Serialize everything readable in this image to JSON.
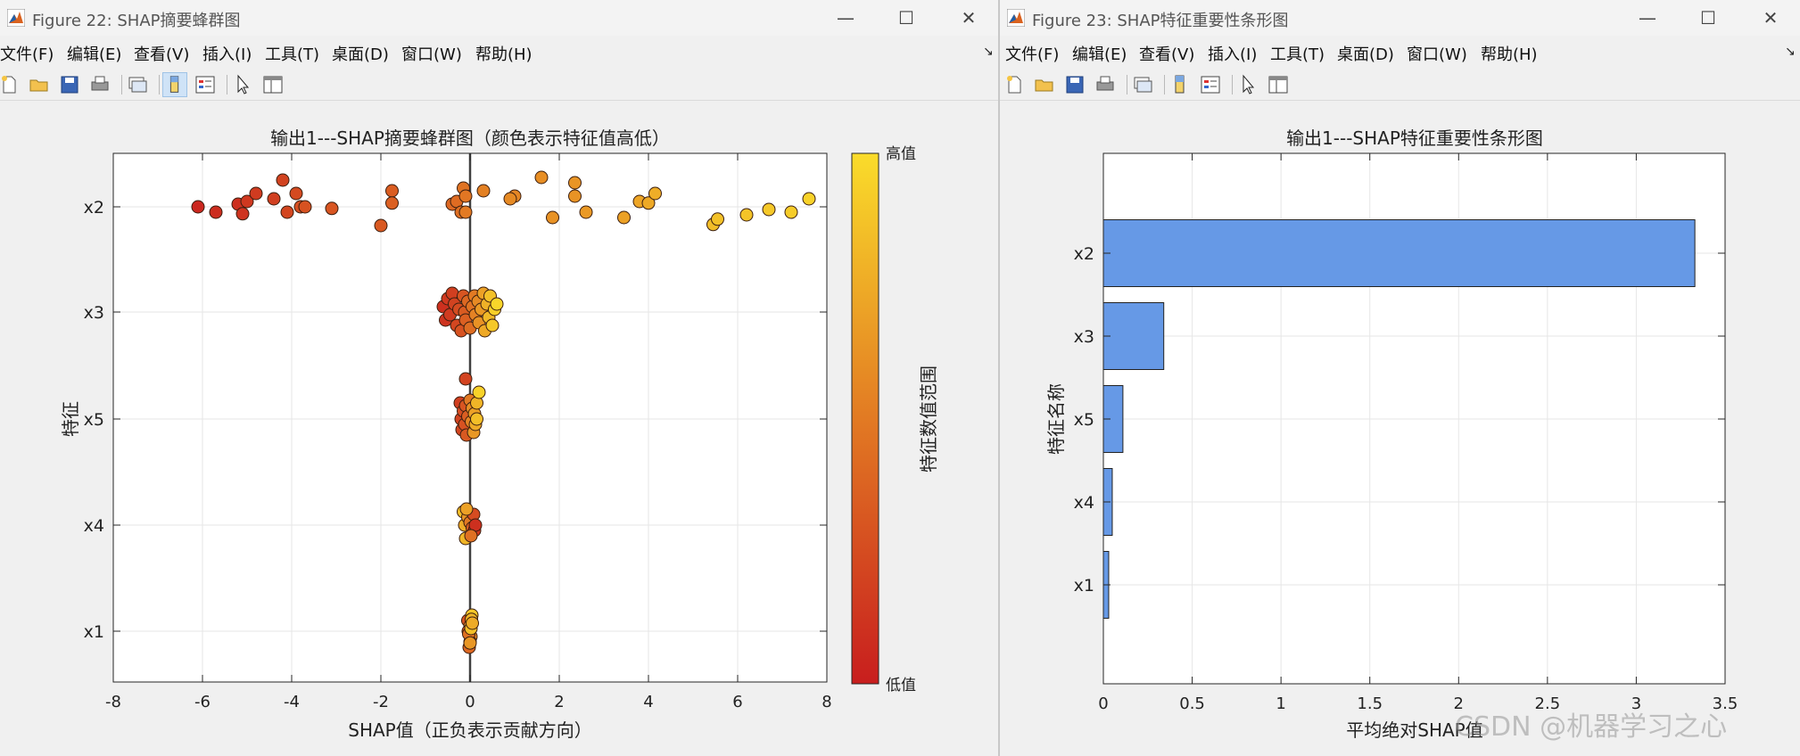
{
  "windows": [
    {
      "id": "left",
      "title": "Figure 22: SHAP摘要蜂群图",
      "menu": [
        "文件(F)",
        "编辑(E)",
        "查看(V)",
        "插入(I)",
        "工具(T)",
        "桌面(D)",
        "窗口(W)",
        "帮助(H)"
      ],
      "menu_arrow": "↘",
      "toolbar_icons": [
        "new-file-icon",
        "open-folder-icon",
        "save-icon",
        "print-icon",
        "link-plot-icon",
        "colorbar-icon",
        "legend-icon",
        "pointer-icon",
        "property-editor-icon"
      ],
      "window_controls": {
        "minimize": "—",
        "maximize": "☐",
        "close": "✕"
      }
    },
    {
      "id": "right",
      "title": "Figure 23: SHAP特征重要性条形图",
      "menu": [
        "文件(F)",
        "编辑(E)",
        "查看(V)",
        "插入(I)",
        "工具(T)",
        "桌面(D)",
        "窗口(W)",
        "帮助(H)"
      ],
      "menu_arrow": "↘",
      "toolbar_icons": [
        "new-file-icon",
        "open-folder-icon",
        "save-icon",
        "print-icon",
        "link-plot-icon",
        "colorbar-icon",
        "legend-icon",
        "pointer-icon",
        "property-editor-icon"
      ],
      "window_controls": {
        "minimize": "—",
        "maximize": "☐",
        "close": "✕"
      }
    }
  ],
  "colors": {
    "bar_fill": "#6699e6",
    "colormap_low": "#c81e1e",
    "colormap_high": "#fadc2a"
  },
  "watermark": "CSDN @机器学习之心",
  "chart_data": [
    {
      "type": "scatter",
      "title": "输出1---SHAP摘要蜂群图（颜色表示特征值高低）",
      "xlabel": "SHAP值（正负表示贡献方向）",
      "ylabel": "特征",
      "xlim": [
        -8,
        8
      ],
      "xticks": [
        -8,
        -6,
        -4,
        -2,
        0,
        2,
        4,
        6,
        8
      ],
      "categories": [
        "x2",
        "x3",
        "x5",
        "x4",
        "x1"
      ],
      "grid": true,
      "colorbar": {
        "label": "特征数值范围",
        "high_label": "高值",
        "low_label": "低值"
      },
      "series": [
        {
          "feature": "x2",
          "points": [
            [
              -6.1,
              0.0,
              0.05
            ],
            [
              -5.7,
              -0.1,
              0.08
            ],
            [
              -5.2,
              0.05,
              0.1
            ],
            [
              -5.1,
              -0.13,
              0.12
            ],
            [
              -5.0,
              0.1,
              0.14
            ],
            [
              -4.8,
              0.25,
              0.16
            ],
            [
              -4.4,
              0.15,
              0.18
            ],
            [
              -4.2,
              0.5,
              0.2
            ],
            [
              -4.1,
              -0.1,
              0.22
            ],
            [
              -3.9,
              0.25,
              0.24
            ],
            [
              -3.8,
              0.0,
              0.26
            ],
            [
              -3.7,
              0.0,
              0.28
            ],
            [
              -3.1,
              -0.03,
              0.3
            ],
            [
              -2.0,
              -0.35,
              0.32
            ],
            [
              -1.75,
              0.3,
              0.34
            ],
            [
              -1.75,
              0.07,
              0.36
            ],
            [
              -0.4,
              0.05,
              0.4
            ],
            [
              -0.3,
              0.1,
              0.42
            ],
            [
              -0.2,
              -0.1,
              0.44
            ],
            [
              -0.15,
              0.35,
              0.46
            ],
            [
              -0.1,
              0.2,
              0.48
            ],
            [
              -0.1,
              -0.1,
              0.5
            ],
            [
              0.3,
              0.3,
              0.53
            ],
            [
              1.0,
              0.2,
              0.56
            ],
            [
              0.9,
              0.15,
              0.58
            ],
            [
              1.6,
              0.55,
              0.6
            ],
            [
              1.85,
              -0.2,
              0.62
            ],
            [
              2.35,
              0.2,
              0.63
            ],
            [
              2.35,
              0.45,
              0.64
            ],
            [
              2.6,
              -0.1,
              0.66
            ],
            [
              3.45,
              -0.2,
              0.7
            ],
            [
              3.8,
              0.1,
              0.72
            ],
            [
              4.0,
              0.07,
              0.74
            ],
            [
              4.15,
              0.25,
              0.76
            ],
            [
              5.45,
              -0.33,
              0.84
            ],
            [
              5.55,
              -0.23,
              0.86
            ],
            [
              6.2,
              -0.15,
              0.88
            ],
            [
              6.7,
              -0.05,
              0.9
            ],
            [
              7.2,
              -0.1,
              0.92
            ],
            [
              7.6,
              0.15,
              0.95
            ]
          ]
        },
        {
          "feature": "x3",
          "points": [
            [
              -0.6,
              0.1,
              0.1
            ],
            [
              -0.55,
              -0.15,
              0.12
            ],
            [
              -0.5,
              0.25,
              0.14
            ],
            [
              -0.45,
              -0.05,
              0.16
            ],
            [
              -0.4,
              0.35,
              0.18
            ],
            [
              -0.35,
              0.15,
              0.2
            ],
            [
              -0.3,
              -0.25,
              0.22
            ],
            [
              -0.25,
              0.05,
              0.25
            ],
            [
              -0.2,
              -0.35,
              0.28
            ],
            [
              -0.15,
              0.3,
              0.3
            ],
            [
              -0.12,
              0.0,
              0.33
            ],
            [
              -0.1,
              -0.15,
              0.36
            ],
            [
              -0.05,
              0.2,
              0.4
            ],
            [
              0.0,
              -0.3,
              0.43
            ],
            [
              0.05,
              0.1,
              0.46
            ],
            [
              0.1,
              0.3,
              0.5
            ],
            [
              0.12,
              -0.05,
              0.54
            ],
            [
              0.18,
              0.2,
              0.58
            ],
            [
              0.2,
              -0.2,
              0.62
            ],
            [
              0.25,
              0.05,
              0.66
            ],
            [
              0.3,
              0.35,
              0.7
            ],
            [
              0.33,
              -0.35,
              0.74
            ],
            [
              0.38,
              0.15,
              0.78
            ],
            [
              0.42,
              -0.1,
              0.82
            ],
            [
              0.45,
              0.3,
              0.86
            ],
            [
              0.5,
              -0.25,
              0.9
            ],
            [
              0.55,
              0.05,
              0.94
            ],
            [
              0.6,
              0.15,
              0.97
            ]
          ]
        },
        {
          "feature": "x5",
          "points": [
            [
              -0.1,
              0.75,
              0.2
            ],
            [
              -0.22,
              0.3,
              0.18
            ],
            [
              -0.2,
              0.0,
              0.2
            ],
            [
              -0.18,
              -0.2,
              0.22
            ],
            [
              -0.15,
              0.15,
              0.25
            ],
            [
              -0.12,
              -0.1,
              0.28
            ],
            [
              -0.1,
              0.25,
              0.3
            ],
            [
              -0.08,
              -0.3,
              0.32
            ],
            [
              -0.05,
              0.05,
              0.35
            ],
            [
              0.0,
              0.35,
              0.5
            ],
            [
              0.03,
              -0.05,
              0.55
            ],
            [
              0.05,
              0.2,
              0.6
            ],
            [
              0.08,
              -0.25,
              0.65
            ],
            [
              0.1,
              0.1,
              0.7
            ],
            [
              0.12,
              -0.1,
              0.75
            ],
            [
              0.15,
              0.3,
              0.8
            ],
            [
              0.15,
              0.0,
              0.85
            ],
            [
              0.2,
              0.5,
              0.95
            ]
          ]
        },
        {
          "feature": "x4",
          "points": [
            [
              -0.15,
              0.25,
              0.85
            ],
            [
              -0.12,
              0.0,
              0.75
            ],
            [
              -0.1,
              -0.25,
              0.8
            ],
            [
              -0.05,
              0.15,
              0.65
            ],
            [
              0.0,
              0.05,
              0.5
            ],
            [
              0.05,
              -0.05,
              0.35
            ],
            [
              0.08,
              0.2,
              0.25
            ],
            [
              0.1,
              -0.1,
              0.15
            ],
            [
              0.12,
              0.0,
              0.1
            ],
            [
              -0.08,
              0.3,
              0.7
            ],
            [
              0.02,
              -0.2,
              0.45
            ]
          ]
        },
        {
          "feature": "x1",
          "points": [
            [
              -0.05,
              0.2,
              0.3
            ],
            [
              -0.02,
              -0.3,
              0.4
            ],
            [
              0.0,
              0.1,
              0.6
            ],
            [
              0.02,
              -0.1,
              0.55
            ],
            [
              0.04,
              0.3,
              0.9
            ],
            [
              -0.04,
              0.0,
              0.35
            ],
            [
              0.0,
              -0.2,
              0.7
            ],
            [
              0.03,
              0.22,
              0.8
            ],
            [
              -0.03,
              -0.05,
              0.45
            ],
            [
              0.02,
              0.05,
              0.85
            ],
            [
              0.0,
              -0.22,
              0.65
            ],
            [
              0.05,
              0.15,
              0.75
            ]
          ]
        }
      ]
    },
    {
      "type": "bar",
      "orientation": "horizontal",
      "title": "输出1---SHAP特征重要性条形图",
      "xlabel": "平均绝对SHAP值",
      "ylabel": "特征名称",
      "xlim": [
        0,
        3.5
      ],
      "xticks": [
        0,
        0.5,
        1,
        1.5,
        2,
        2.5,
        3,
        3.5
      ],
      "categories": [
        "x2",
        "x3",
        "x5",
        "x4",
        "x1"
      ],
      "values": [
        3.33,
        0.34,
        0.11,
        0.05,
        0.03
      ],
      "grid": true
    }
  ]
}
